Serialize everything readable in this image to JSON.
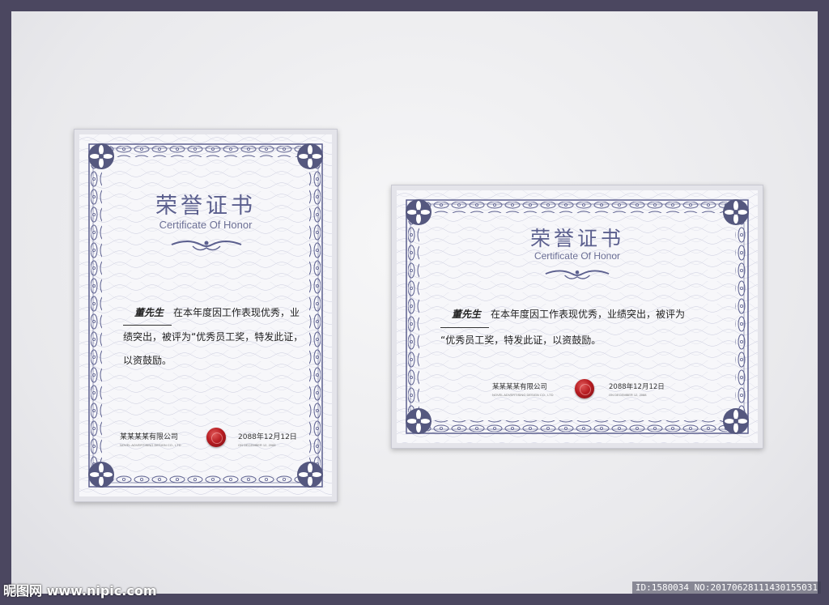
{
  "portrait": {
    "title": "荣誉证书",
    "subtitle": "Certificate Of Honor",
    "recipient": "董先生",
    "line1": "在本年度因工作表现优秀，业",
    "line2": "绩突出，被评为“优秀员工奖，特发此证，",
    "line3": "以资鼓励。",
    "company_cn": "某某某某有限公司",
    "company_en": "NOVEL ADVERTISING DESIGN CO., LTD",
    "date_cn": "2088年12月12日",
    "date_en": "ON DECEMBER 12, 2088"
  },
  "landscape": {
    "title": "荣誉证书",
    "subtitle": "Certificate Of Honor",
    "recipient": "董先生",
    "line1": "在本年度因工作表现优秀，业绩突出，被评为",
    "line2": "“优秀员工奖，特发此证，以资鼓励。",
    "company_cn": "某某某某有限公司",
    "company_en": "NOVEL ADVERTISING DESIGN CO., LTD",
    "date_cn": "2088年12月12日",
    "date_en": "ON DECEMBER 12, 2088"
  },
  "watermark": {
    "left": "昵图网 www.nipic.com",
    "right": "ID:1580034 NO:20170628111430155031"
  },
  "colors": {
    "frame": "#55587f",
    "seal": "#b81d22"
  }
}
